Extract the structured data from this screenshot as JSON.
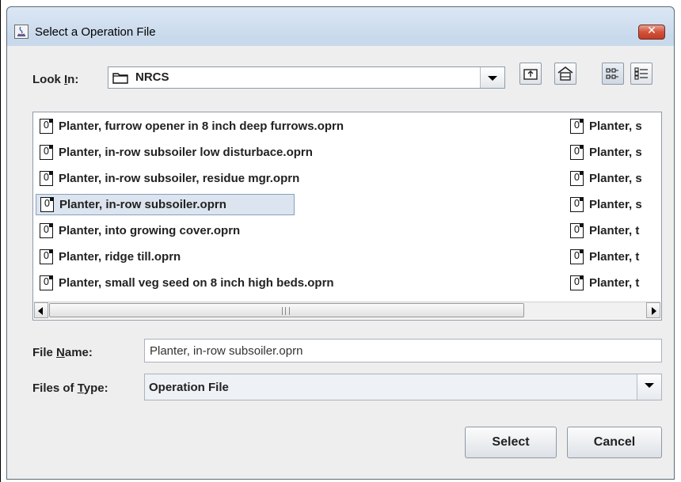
{
  "window": {
    "title": "Select a Operation File",
    "close_glyph": "✕"
  },
  "look_in": {
    "label_pre": "Look ",
    "label_u": "I",
    "label_post": "n:",
    "folder": "NRCS",
    "icon": "folder-icon"
  },
  "toolbar": {
    "icons": [
      "up-folder-icon",
      "home-icon",
      "list-view-icon",
      "details-view-icon"
    ]
  },
  "files": {
    "column1": [
      "Planter, furrow opener in 8 inch deep furrows.oprn",
      "Planter, in-row subsoiler low disturbace.oprn",
      "Planter, in-row subsoiler, residue mgr.oprn",
      "Planter, in-row subsoiler.oprn",
      "Planter, into growing cover.oprn",
      "Planter, ridge till.oprn",
      "Planter, small veg seed on 8 inch high beds.oprn"
    ],
    "column2": [
      "Planter, s",
      "Planter, s",
      "Planter, s",
      "Planter, s",
      "Planter, t",
      "Planter, t",
      "Planter, t"
    ],
    "selected_index": 3,
    "file_icon_glyph": "0"
  },
  "file_name": {
    "label_pre": "File ",
    "label_u": "N",
    "label_post": "ame:",
    "value": "Planter, in-row subsoiler.oprn"
  },
  "file_type": {
    "label_pre": "Files of ",
    "label_u": "T",
    "label_post": "ype:",
    "value": "Operation File"
  },
  "buttons": {
    "select": "Select",
    "cancel": "Cancel"
  }
}
